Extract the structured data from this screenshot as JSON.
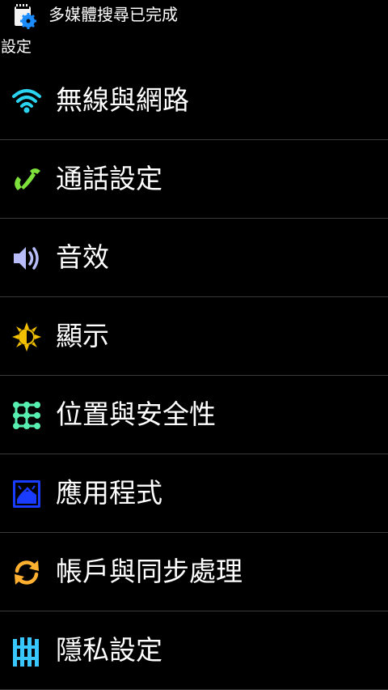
{
  "statusbar": {
    "icon": "media-scan-settings-icon",
    "text": "多媒體搜尋已完成"
  },
  "header": {
    "title": "設定"
  },
  "menu": {
    "items": [
      {
        "label": "無線與網路",
        "icon": "wifi-icon",
        "color": "#2ad4f0"
      },
      {
        "label": "通話設定",
        "icon": "phone-icon",
        "color": "#7ee03a"
      },
      {
        "label": "音效",
        "icon": "speaker-icon",
        "color": "#b8bcf8"
      },
      {
        "label": "顯示",
        "icon": "brightness-icon",
        "color": "#f2c000"
      },
      {
        "label": "位置與安全性",
        "icon": "location-security-icon",
        "color": "#58f0b0"
      },
      {
        "label": "應用程式",
        "icon": "applications-icon",
        "color": "#1a3cff"
      },
      {
        "label": "帳戶與同步處理",
        "icon": "sync-icon",
        "color": "#ffb030"
      },
      {
        "label": "隱私設定",
        "icon": "privacy-icon",
        "color": "#38c8ff"
      }
    ]
  }
}
